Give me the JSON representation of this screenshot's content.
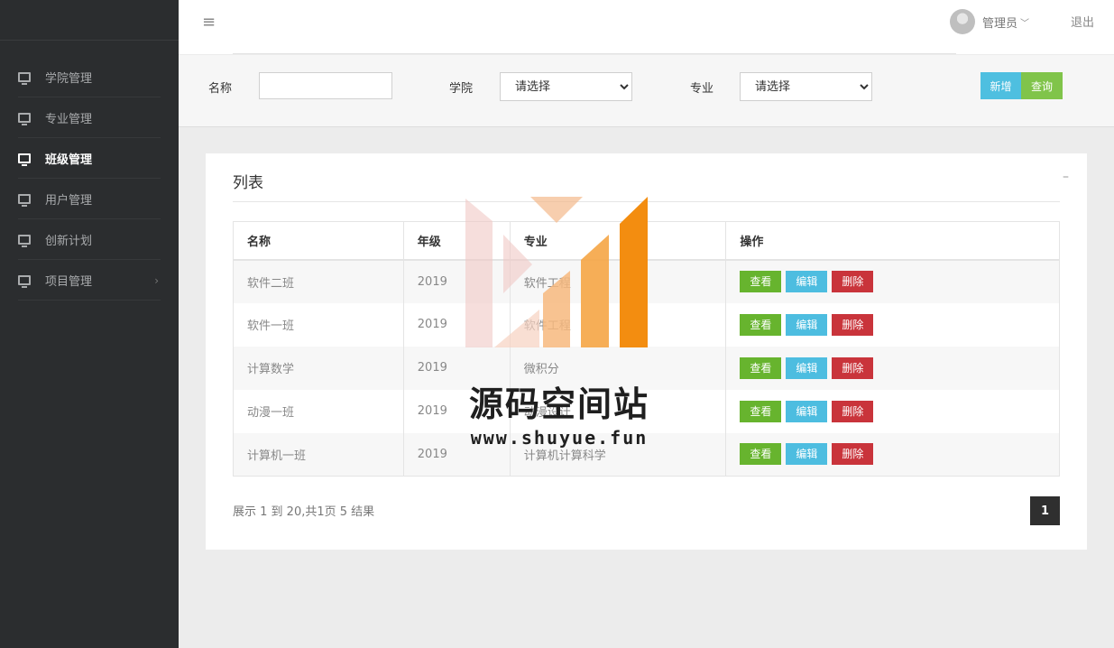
{
  "sidebar": {
    "items": [
      {
        "label": "学院管理",
        "icon": "monitor-icon",
        "active": false
      },
      {
        "label": "专业管理",
        "icon": "monitor-icon",
        "active": false
      },
      {
        "label": "班级管理",
        "icon": "monitor-icon",
        "active": true
      },
      {
        "label": "用户管理",
        "icon": "monitor-icon",
        "active": false
      },
      {
        "label": "创新计划",
        "icon": "monitor-icon",
        "active": false
      },
      {
        "label": "项目管理",
        "icon": "monitor-icon",
        "active": false,
        "arrow": "›"
      }
    ]
  },
  "header": {
    "menu_icon": "≡",
    "user_name": "管理员",
    "user_chevron": "﹀",
    "logout": "退出"
  },
  "filter": {
    "name_label": "名称",
    "name_value": "",
    "college_label": "学院",
    "college_selected": "请选择",
    "major_label": "专业",
    "major_selected": "请选择",
    "add_label": "新增",
    "search_label": "查询"
  },
  "panel": {
    "title": "列表",
    "collapse": "–"
  },
  "table": {
    "headers": [
      "名称",
      "年级",
      "专业",
      "操作"
    ],
    "rows": [
      {
        "name": "软件二班",
        "grade": "2019",
        "major": "软件工程"
      },
      {
        "name": "软件一班",
        "grade": "2019",
        "major": "软件工程"
      },
      {
        "name": "计算数学",
        "grade": "2019",
        "major": "微积分"
      },
      {
        "name": "动漫一班",
        "grade": "2019",
        "major": "动漫设计"
      },
      {
        "name": "计算机一班",
        "grade": "2019",
        "major": "计算机计算科学"
      }
    ],
    "actions": {
      "view": "查看",
      "edit": "编辑",
      "delete": "删除"
    }
  },
  "pagination": {
    "info": "展示 1 到 20,共1页 5 结果",
    "current_page": "1"
  },
  "watermark": {
    "title": "源码空间站",
    "url": "www.shuyue.fun"
  },
  "colors": {
    "sidebar_bg": "#2b2d2f",
    "btn_add": "#4ebfe0",
    "btn_search": "#80c44a",
    "btn_view": "#67b42e",
    "btn_edit": "#4dbde0",
    "btn_delete": "#c9343b",
    "pager_bg": "#2f2f2f"
  }
}
